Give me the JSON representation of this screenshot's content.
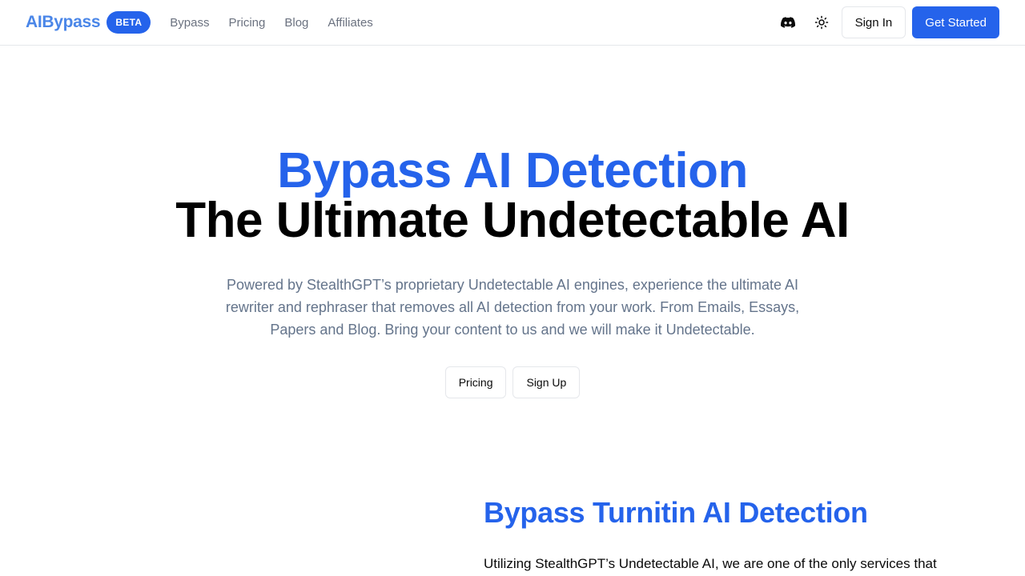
{
  "header": {
    "logo": "AIBypass",
    "badge": "BETA",
    "nav": [
      {
        "label": "Bypass"
      },
      {
        "label": "Pricing"
      },
      {
        "label": "Blog"
      },
      {
        "label": "Affiliates"
      }
    ],
    "discord_icon": "discord-icon",
    "theme_icon": "sun-icon",
    "sign_in": "Sign In",
    "get_started": "Get Started"
  },
  "hero": {
    "title_line1": "Bypass AI Detection",
    "title_line2": "The Ultimate Undetectable AI",
    "description": "Powered by StealthGPT’s proprietary Undetectable AI engines, experience the ultimate AI rewriter and rephraser that removes all AI detection from your work. From Emails, Essays, Papers and Blog. Bring your content to us and we will make it Undetectable.",
    "pricing_button": "Pricing",
    "signup_button": "Sign Up"
  },
  "feature": {
    "title": "Bypass Turnitin AI Detection",
    "text": "Utilizing StealthGPT’s Undetectable AI, we are one of the only services that"
  },
  "colors": {
    "accent": "#2563eb",
    "logo": "#4a86e8",
    "muted_text": "#64748b",
    "border": "#e5e7eb"
  }
}
